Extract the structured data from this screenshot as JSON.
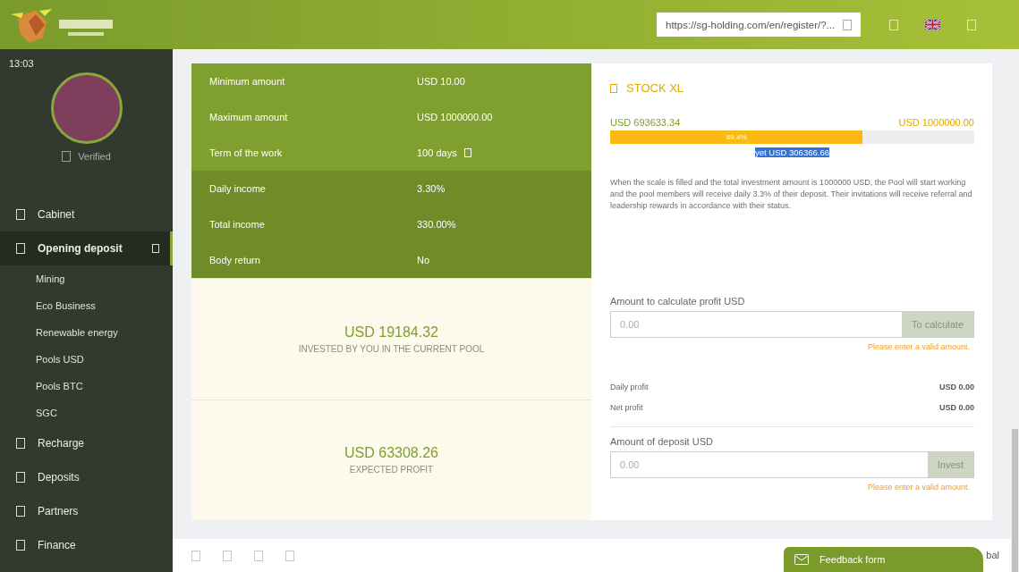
{
  "header": {
    "referral_link": "https://sg-holding.com/en/register/?..."
  },
  "sidebar": {
    "time": "13:03",
    "status": "Verified",
    "items": [
      {
        "label": "Cabinet",
        "kind": "main",
        "selected": false
      },
      {
        "label": "Opening deposit",
        "kind": "main",
        "selected": true,
        "expanded": true,
        "children": [
          {
            "label": "Mining",
            "kind": "sub",
            "selected": false
          },
          {
            "label": "Eco Business",
            "kind": "sub",
            "selected": false
          },
          {
            "label": "Renewable energy",
            "kind": "sub",
            "selected": false
          },
          {
            "label": "Pools USD",
            "kind": "sub",
            "selected": false
          },
          {
            "label": "Pools BTC",
            "kind": "sub",
            "selected": false
          },
          {
            "label": "SGC",
            "kind": "sub",
            "selected": false
          }
        ]
      },
      {
        "label": "Recharge",
        "kind": "main",
        "selected": false
      },
      {
        "label": "Deposits",
        "kind": "main",
        "selected": false
      },
      {
        "label": "Partners",
        "kind": "main",
        "selected": false
      },
      {
        "label": "Finance",
        "kind": "main",
        "selected": false
      }
    ]
  },
  "terms": [
    {
      "label": "Minimum amount",
      "value": "USD 10.00",
      "highlighted": false
    },
    {
      "label": "Maximum amount",
      "value": "USD 1000000.00",
      "highlighted": false
    },
    {
      "label": "Term of the work",
      "value": "100 days",
      "highlighted": false,
      "info": true
    },
    {
      "label": "Daily income",
      "value": "3.30%",
      "highlighted": true
    },
    {
      "label": "Total income",
      "value": "330.00%",
      "highlighted": true
    },
    {
      "label": "Body return",
      "value": "No",
      "highlighted": true
    }
  ],
  "stats": [
    {
      "value": "USD 19184.32",
      "caption": "INVESTED BY YOU IN THE CURRENT POOL"
    },
    {
      "value": "USD 63308.26",
      "caption": "EXPECTED PROFIT"
    }
  ],
  "pool": {
    "title": "STOCK XL",
    "collected": "USD 693633.34",
    "target": "USD 1000000.00",
    "level": 0.694,
    "percent": "69.4%",
    "remaining": "yet USD 306366.66",
    "description": "When the scale is filled and the total investment amount is 1000000 USD, the Pool will start working and the pool members will receive daily 3.3% of their deposit. Their invitations will receive referral and leadership rewards in accordance with their status."
  },
  "calculator": {
    "label": "Amount to calculate profit USD",
    "placeholder": "0.00",
    "button": "To calculate",
    "error": "Please enter a valid amount.",
    "results": [
      {
        "label": "Daily profit",
        "value": "USD 0.00"
      },
      {
        "label": "Net profit",
        "value": "USD 0.00"
      }
    ]
  },
  "deposit": {
    "label": "Amount of deposit USD",
    "placeholder": "0.00",
    "button": "Invest",
    "error": "Please enter a valid amount."
  },
  "footer": {
    "trailing_text": "bal",
    "feedback": "Feedback form"
  }
}
